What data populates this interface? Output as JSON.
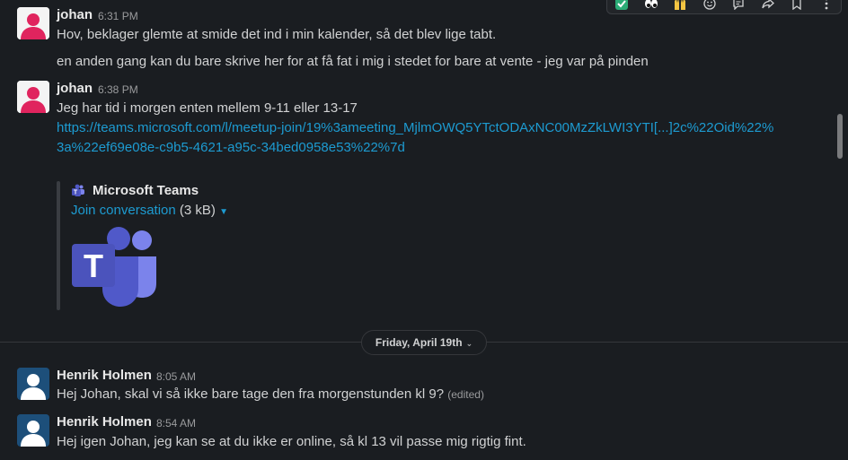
{
  "messages": [
    {
      "author": "johan",
      "time": "6:31 PM",
      "lines": [
        "Hov, beklager glemte at smide det ind i min kalender, så det blev lige tabt."
      ]
    },
    {
      "continuation": "en anden gang kan du bare skrive her for at få fat i mig i stedet for bare at vente - jeg var på pinden"
    },
    {
      "author": "johan",
      "time": "6:38 PM",
      "text": "Jeg har tid i morgen enten mellem 9-11 eller 13-17",
      "link": "https://teams.microsoft.com/l/meetup-join/19%3ameeting_MjlmOWQ5YTctODAxNC00MzZkLWI3YTI[...]2c%22Oid%22%3a%22ef69e08e-c9b5-4621-a95c-34bed0958e53%22%7d",
      "unfurl": {
        "title": "Microsoft Teams",
        "link_label": "Join conversation",
        "size": "(3 kB)"
      }
    },
    {
      "author": "Henrik Holmen",
      "time": "8:05 AM",
      "text": "Hej Johan,  skal vi så ikke bare tage den fra morgenstunden kl 9?",
      "edited": "(edited)"
    },
    {
      "author": "Henrik Holmen",
      "time": "8:54 AM",
      "text": "Hej igen Johan, jeg kan se at du ikke er online, så kl 13 vil passe mig rigtig fint."
    }
  ],
  "date_divider": "Friday, April 19th",
  "toolbar": {
    "icons": [
      "check-mark-icon",
      "eyes-icon",
      "raised-hands-icon",
      "add-reaction-icon",
      "reply-in-thread-icon",
      "share-icon",
      "bookmark-icon",
      "more-icon"
    ]
  },
  "colors": {
    "background": "#1a1d21",
    "link": "#1d9bd1",
    "teams_purple": "#5059c9"
  }
}
